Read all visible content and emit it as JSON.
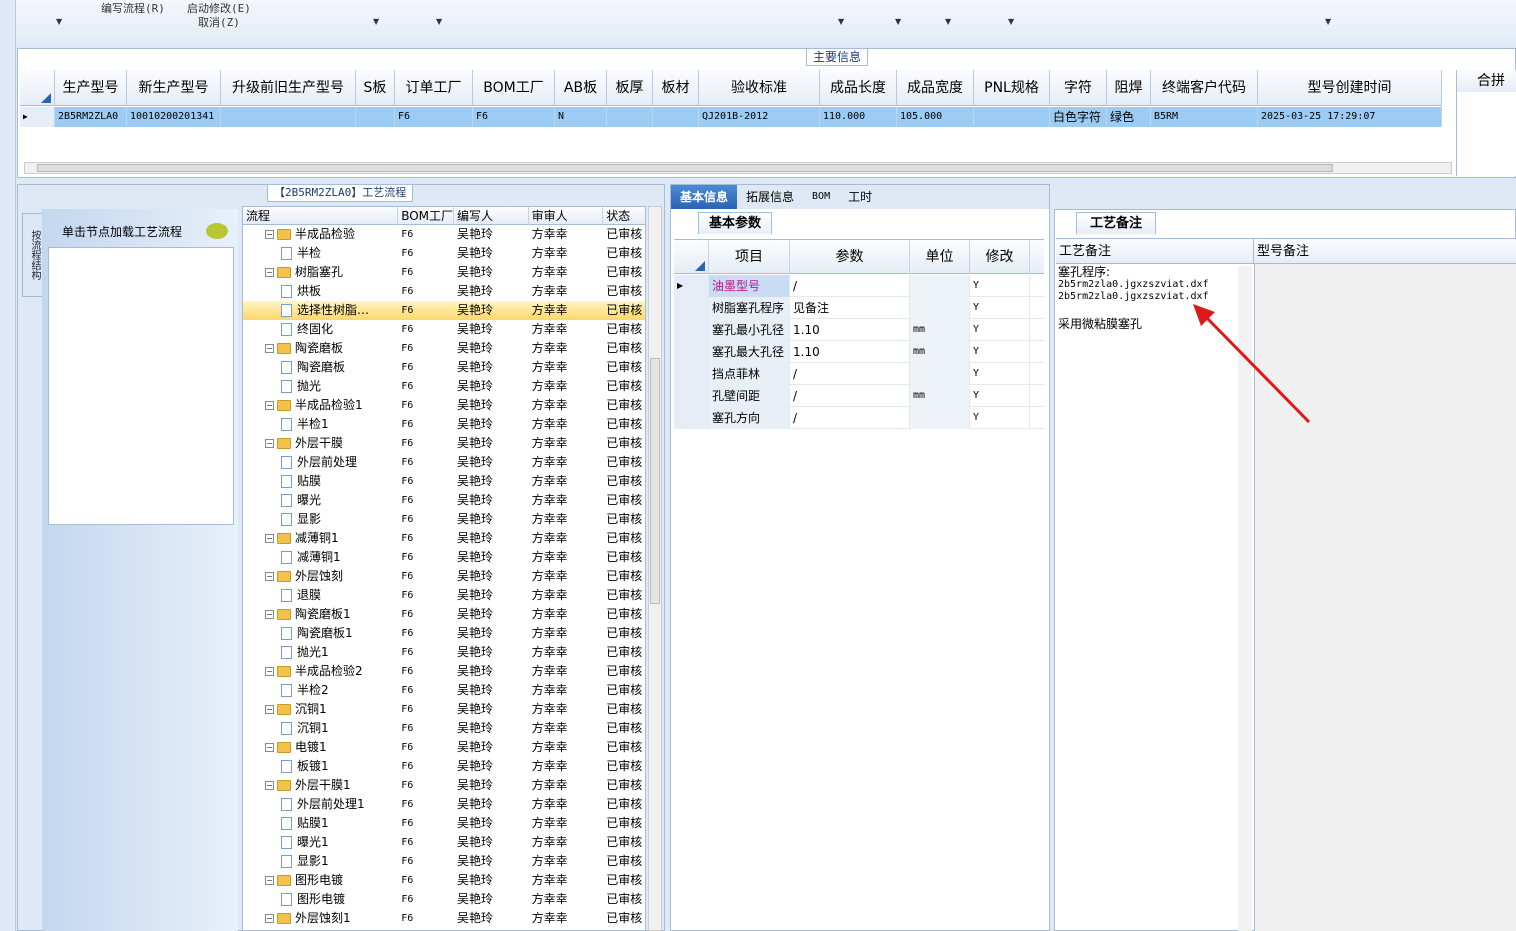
{
  "toolbar": {
    "edit_flow": "编写流程(R)",
    "start_modify": "启动修改(E)",
    "cancel": "取消(Z)"
  },
  "main_info": {
    "title": "主要信息",
    "columns": [
      "生产型号",
      "新生产型号",
      "升级前旧生产型号",
      "S板",
      "订单工厂",
      "BOM工厂",
      "AB板",
      "板厚",
      "板材",
      "验收标准",
      "成品长度",
      "成品宽度",
      "PNL规格",
      "字符",
      "阻焊",
      "终端客户代码",
      "型号创建时间"
    ],
    "row": [
      "2B5RM2ZLA0",
      "10010200201341",
      "",
      "",
      "F6",
      "F6",
      "N",
      "",
      "",
      "QJ201B-2012",
      "110.000",
      "105.000",
      "",
      "白色字符",
      "绿色",
      "B5RM",
      "2025-03-25 17:29:07"
    ],
    "right_header": "合拼"
  },
  "flow": {
    "title": "【2B5RM2ZLA0】工艺流程",
    "side_tab": "按流程结构",
    "side_hint": "单击节点加载工艺流程",
    "columns": [
      "流程",
      "BOM工厂",
      "编写人",
      "审审人",
      "状态"
    ],
    "rows": [
      {
        "name": "半成品检验",
        "level": 0,
        "factory": "F6",
        "writer": "吴艳玲",
        "reviewer": "方幸幸",
        "status": "已审核"
      },
      {
        "name": "半检",
        "level": 1,
        "factory": "F6",
        "writer": "吴艳玲",
        "reviewer": "方幸幸",
        "status": "已审核"
      },
      {
        "name": "树脂塞孔",
        "level": 0,
        "factory": "F6",
        "writer": "吴艳玲",
        "reviewer": "方幸幸",
        "status": "已审核"
      },
      {
        "name": "烘板",
        "level": 1,
        "factory": "F6",
        "writer": "吴艳玲",
        "reviewer": "方幸幸",
        "status": "已审核"
      },
      {
        "name": "选择性树脂…",
        "level": 1,
        "factory": "F6",
        "writer": "吴艳玲",
        "reviewer": "方幸幸",
        "status": "已审核",
        "selected": true
      },
      {
        "name": "终固化",
        "level": 1,
        "factory": "F6",
        "writer": "吴艳玲",
        "reviewer": "方幸幸",
        "status": "已审核"
      },
      {
        "name": "陶瓷磨板",
        "level": 0,
        "factory": "F6",
        "writer": "吴艳玲",
        "reviewer": "方幸幸",
        "status": "已审核"
      },
      {
        "name": "陶瓷磨板",
        "level": 1,
        "factory": "F6",
        "writer": "吴艳玲",
        "reviewer": "方幸幸",
        "status": "已审核"
      },
      {
        "name": "抛光",
        "level": 1,
        "factory": "F6",
        "writer": "吴艳玲",
        "reviewer": "方幸幸",
        "status": "已审核"
      },
      {
        "name": "半成品检验1",
        "level": 0,
        "factory": "F6",
        "writer": "吴艳玲",
        "reviewer": "方幸幸",
        "status": "已审核"
      },
      {
        "name": "半检1",
        "level": 1,
        "factory": "F6",
        "writer": "吴艳玲",
        "reviewer": "方幸幸",
        "status": "已审核"
      },
      {
        "name": "外层干膜",
        "level": 0,
        "factory": "F6",
        "writer": "吴艳玲",
        "reviewer": "方幸幸",
        "status": "已审核"
      },
      {
        "name": "外层前处理",
        "level": 1,
        "factory": "F6",
        "writer": "吴艳玲",
        "reviewer": "方幸幸",
        "status": "已审核"
      },
      {
        "name": "贴膜",
        "level": 1,
        "factory": "F6",
        "writer": "吴艳玲",
        "reviewer": "方幸幸",
        "status": "已审核"
      },
      {
        "name": "曝光",
        "level": 1,
        "factory": "F6",
        "writer": "吴艳玲",
        "reviewer": "方幸幸",
        "status": "已审核"
      },
      {
        "name": "显影",
        "level": 1,
        "factory": "F6",
        "writer": "吴艳玲",
        "reviewer": "方幸幸",
        "status": "已审核"
      },
      {
        "name": "减薄铜1",
        "level": 0,
        "factory": "F6",
        "writer": "吴艳玲",
        "reviewer": "方幸幸",
        "status": "已审核"
      },
      {
        "name": "减薄铜1",
        "level": 1,
        "factory": "F6",
        "writer": "吴艳玲",
        "reviewer": "方幸幸",
        "status": "已审核"
      },
      {
        "name": "外层蚀刻",
        "level": 0,
        "factory": "F6",
        "writer": "吴艳玲",
        "reviewer": "方幸幸",
        "status": "已审核"
      },
      {
        "name": "退膜",
        "level": 1,
        "factory": "F6",
        "writer": "吴艳玲",
        "reviewer": "方幸幸",
        "status": "已审核"
      },
      {
        "name": "陶瓷磨板1",
        "level": 0,
        "factory": "F6",
        "writer": "吴艳玲",
        "reviewer": "方幸幸",
        "status": "已审核"
      },
      {
        "name": "陶瓷磨板1",
        "level": 1,
        "factory": "F6",
        "writer": "吴艳玲",
        "reviewer": "方幸幸",
        "status": "已审核"
      },
      {
        "name": "抛光1",
        "level": 1,
        "factory": "F6",
        "writer": "吴艳玲",
        "reviewer": "方幸幸",
        "status": "已审核"
      },
      {
        "name": "半成品检验2",
        "level": 0,
        "factory": "F6",
        "writer": "吴艳玲",
        "reviewer": "方幸幸",
        "status": "已审核"
      },
      {
        "name": "半检2",
        "level": 1,
        "factory": "F6",
        "writer": "吴艳玲",
        "reviewer": "方幸幸",
        "status": "已审核"
      },
      {
        "name": "沉铜1",
        "level": 0,
        "factory": "F6",
        "writer": "吴艳玲",
        "reviewer": "方幸幸",
        "status": "已审核"
      },
      {
        "name": "沉铜1",
        "level": 1,
        "factory": "F6",
        "writer": "吴艳玲",
        "reviewer": "方幸幸",
        "status": "已审核"
      },
      {
        "name": "电镀1",
        "level": 0,
        "factory": "F6",
        "writer": "吴艳玲",
        "reviewer": "方幸幸",
        "status": "已审核"
      },
      {
        "name": "板镀1",
        "level": 1,
        "factory": "F6",
        "writer": "吴艳玲",
        "reviewer": "方幸幸",
        "status": "已审核"
      },
      {
        "name": "外层干膜1",
        "level": 0,
        "factory": "F6",
        "writer": "吴艳玲",
        "reviewer": "方幸幸",
        "status": "已审核"
      },
      {
        "name": "外层前处理1",
        "level": 1,
        "factory": "F6",
        "writer": "吴艳玲",
        "reviewer": "方幸幸",
        "status": "已审核"
      },
      {
        "name": "贴膜1",
        "level": 1,
        "factory": "F6",
        "writer": "吴艳玲",
        "reviewer": "方幸幸",
        "status": "已审核"
      },
      {
        "name": "曝光1",
        "level": 1,
        "factory": "F6",
        "writer": "吴艳玲",
        "reviewer": "方幸幸",
        "status": "已审核"
      },
      {
        "name": "显影1",
        "level": 1,
        "factory": "F6",
        "writer": "吴艳玲",
        "reviewer": "方幸幸",
        "status": "已审核"
      },
      {
        "name": "图形电镀",
        "level": 0,
        "factory": "F6",
        "writer": "吴艳玲",
        "reviewer": "方幸幸",
        "status": "已审核"
      },
      {
        "name": "图形电镀",
        "level": 1,
        "factory": "F6",
        "writer": "吴艳玲",
        "reviewer": "方幸幸",
        "status": "已审核"
      },
      {
        "name": "外层蚀刻1",
        "level": 0,
        "factory": "F6",
        "writer": "吴艳玲",
        "reviewer": "方幸幸",
        "status": "已审核"
      }
    ]
  },
  "detail": {
    "tabs": [
      "基本信息",
      "拓展信息",
      "BOM",
      "工时"
    ],
    "subtab": "基本参数",
    "columns": [
      "项目",
      "参数",
      "单位",
      "修改"
    ],
    "rows": [
      {
        "item": "油墨型号",
        "value": "/",
        "unit": "",
        "mod": "Y",
        "current": true
      },
      {
        "item": "树脂塞孔程序",
        "value": "见备注",
        "unit": "",
        "mod": "Y"
      },
      {
        "item": "塞孔最小孔径",
        "value": "1.10",
        "unit": "mm",
        "mod": "Y"
      },
      {
        "item": "塞孔最大孔径",
        "value": "1.10",
        "unit": "mm",
        "mod": "Y"
      },
      {
        "item": "挡点菲林",
        "value": "/",
        "unit": "",
        "mod": "Y"
      },
      {
        "item": "孔壁间距",
        "value": "/",
        "unit": "mm",
        "mod": "Y"
      },
      {
        "item": "塞孔方向",
        "value": "/",
        "unit": "",
        "mod": "Y"
      }
    ]
  },
  "notes": {
    "tab": "工艺备注",
    "col1": "工艺备注",
    "col2": "型号备注",
    "label": "塞孔程序:",
    "file1": "2b5rm2zla0.jgxzszviat.dxf",
    "file2": "2b5rm2zla0.jgxzszviat.dxf",
    "text": "采用微粘膜塞孔"
  },
  "colors": {
    "accent": "#2a63b4",
    "selected_row": "#9ccbf4",
    "arrow": "#e01818"
  }
}
